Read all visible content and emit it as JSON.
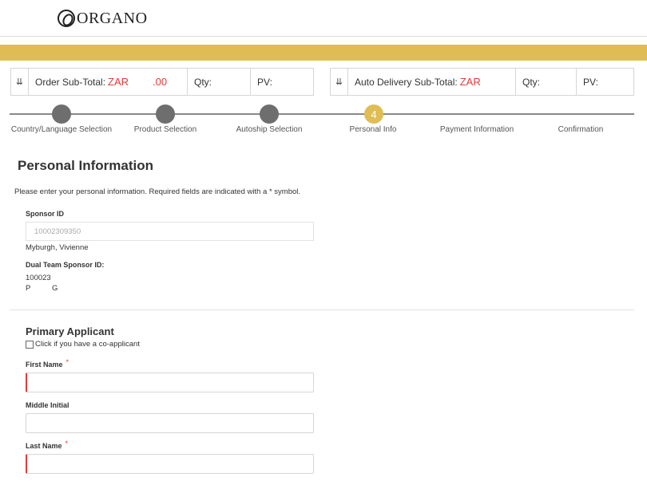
{
  "brand": {
    "logo_text": "ORGANO"
  },
  "order_summary": {
    "label": "Order Sub-Total:",
    "currency": "ZAR",
    "amount": ".00",
    "qty_label": "Qty:",
    "pv_label": "PV:"
  },
  "autodelivery_summary": {
    "label": "Auto Delivery Sub-Total:",
    "currency": "ZAR",
    "qty_label": "Qty:",
    "pv_label": "PV:"
  },
  "steps": [
    {
      "label": "Country/Language Selection",
      "status": "completed"
    },
    {
      "label": "Product Selection",
      "status": "completed"
    },
    {
      "label": "Autoship Selection",
      "status": "completed"
    },
    {
      "label": "Personal Info",
      "number": "4",
      "status": "active"
    },
    {
      "label": "Payment Information",
      "status": "pending"
    },
    {
      "label": "Confirmation",
      "status": "pending"
    }
  ],
  "page": {
    "title": "Personal Information",
    "intro": "Please enter your personal information. Required fields are indicated with a * symbol."
  },
  "sponsor": {
    "id_label": "Sponsor ID",
    "id_value": "10002309350",
    "name": "Myburgh, Vivienne",
    "dual_label": "Dual Team Sponsor ID:",
    "dual_value": "100023",
    "dual_p": "P",
    "dual_g": "G"
  },
  "applicant": {
    "title": "Primary Applicant",
    "coapp_label": "Click if you have a co-applicant",
    "first_name_label": "First Name",
    "middle_initial_label": "Middle Initial",
    "last_name_label": "Last Name",
    "required_mark": "*"
  },
  "colors": {
    "gold": "#e0bd54",
    "accent_red": "#e23b3b",
    "step_complete": "#6e6e6e"
  }
}
